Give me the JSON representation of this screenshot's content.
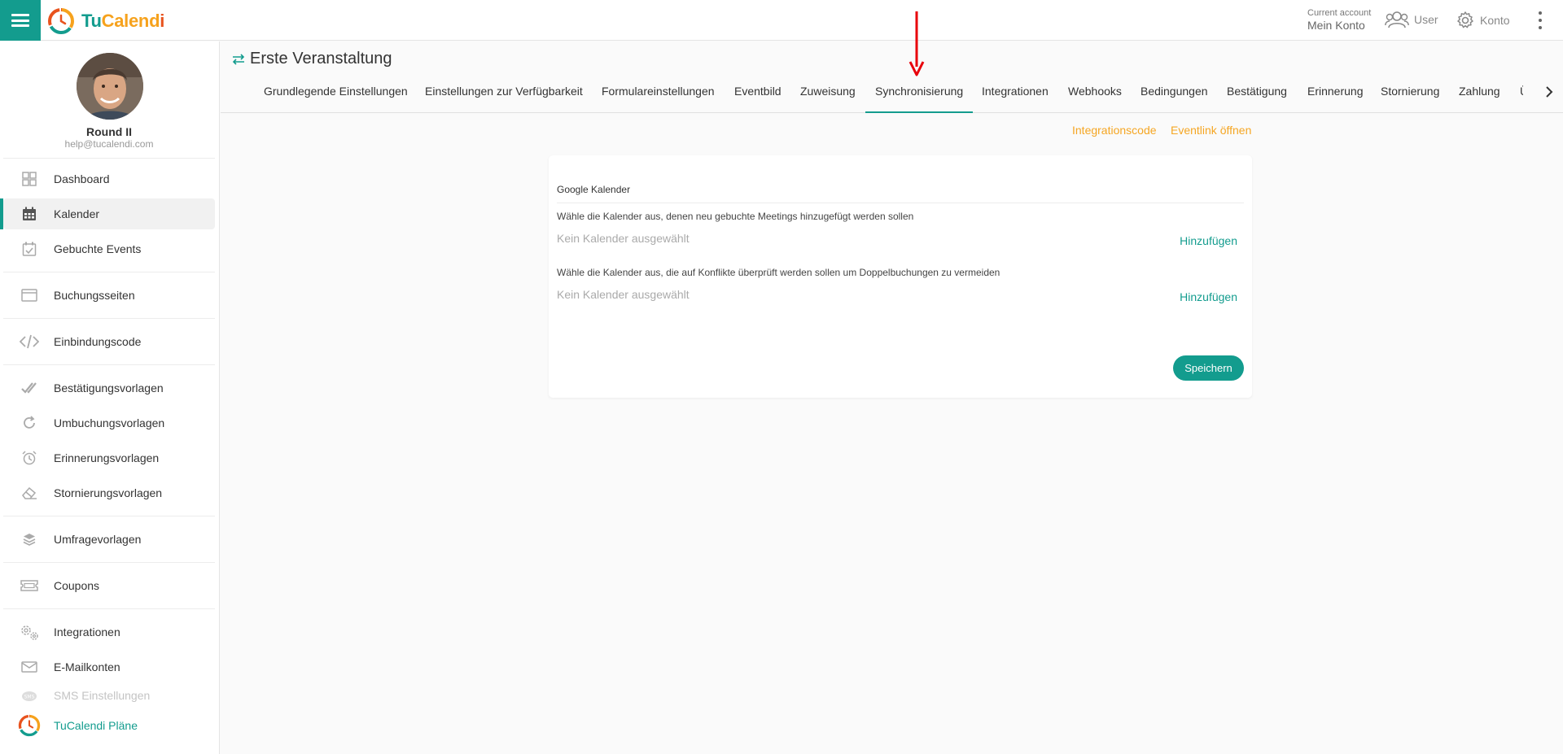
{
  "app": {
    "brand_tu": "Tu",
    "brand_cal": "Calend",
    "brand_i": "i",
    "colors": {
      "primary": "#139c8e",
      "accent": "#f5a623",
      "annotation": "#e8000b"
    }
  },
  "header": {
    "account_caption": "Current account",
    "account_name": "Mein Konto",
    "user_label": "User",
    "settings_label": "Konto"
  },
  "sidebar": {
    "user_name": "Round II",
    "user_email": "help@tucalendi.com",
    "items": [
      {
        "label": "Dashboard",
        "icon": "dashboard-icon"
      },
      {
        "label": "Kalender",
        "icon": "calendar-icon"
      },
      {
        "label": "Gebuchte Events",
        "icon": "calendar-check-icon"
      },
      {
        "label": "Buchungsseiten",
        "icon": "browser-window-icon"
      },
      {
        "label": "Einbindungscode",
        "icon": "code-icon"
      },
      {
        "label": "Bestätigungsvorlagen",
        "icon": "double-check-icon"
      },
      {
        "label": "Umbuchungsvorlagen",
        "icon": "refresh-icon"
      },
      {
        "label": "Erinnerungsvorlagen",
        "icon": "alarm-clock-icon"
      },
      {
        "label": "Stornierungsvorlagen",
        "icon": "eraser-icon"
      },
      {
        "label": "Umfragevorlagen",
        "icon": "layers-icon"
      },
      {
        "label": "Coupons",
        "icon": "ticket-icon"
      },
      {
        "label": "Integrationen",
        "icon": "gears-icon"
      },
      {
        "label": "E-Mailkonten",
        "icon": "envelope-icon"
      },
      {
        "label": "SMS Einstellungen",
        "icon": "sms-icon"
      },
      {
        "label": "TuCalendi Pläne",
        "icon": "tucalendi-logo-icon"
      }
    ]
  },
  "event": {
    "title": "Erste Veranstaltung",
    "tabs": [
      "Grundlegende Einstellungen",
      "Einstellungen zur Verfügbarkeit",
      "Formulareinstellungen",
      "Eventbild",
      "Zuweisung",
      "Synchronisierung",
      "Integrationen",
      "Webhooks",
      "Bedingungen",
      "Bestätigung",
      "Erinnerung",
      "Stornierung",
      "Zahlung",
      "Üb"
    ],
    "active_tab": "Synchronisierung",
    "links": {
      "integration_code": "Integrationscode",
      "open_event_link": "Eventlink öffnen"
    }
  },
  "sync_card": {
    "title": "Google Kalender",
    "add_label": "Wähle die Kalender aus, denen neu gebuchte Meetings hinzugefügt werden sollen",
    "add_empty": "Kein Kalender ausgewählt",
    "add_button": "Hinzufügen",
    "conflict_label": "Wähle die Kalender aus, die auf Konflikte überprüft werden sollen um Doppelbuchungen zu vermeiden",
    "conflict_empty": "Kein Kalender ausgewählt",
    "conflict_button": "Hinzufügen",
    "save_button": "Speichern"
  }
}
